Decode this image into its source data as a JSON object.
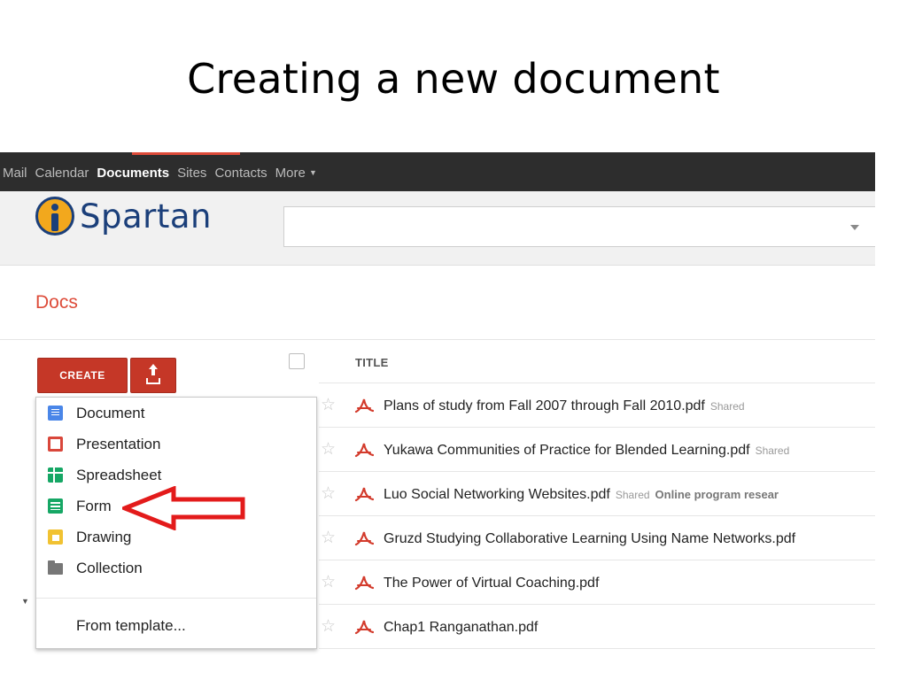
{
  "slide": {
    "title": "Creating a new document"
  },
  "topnav": {
    "items": [
      "Mail",
      "Calendar",
      "Documents",
      "Sites",
      "Contacts",
      "More"
    ],
    "active": "Documents"
  },
  "brand": {
    "logo_text": "Spartan"
  },
  "search": {
    "value": "",
    "placeholder": ""
  },
  "page": {
    "title": "Docs"
  },
  "toolbar": {
    "create_label": "CREATE",
    "upload_icon": "upload-icon"
  },
  "create_menu": {
    "items": [
      {
        "label": "Document",
        "icon": "document-icon",
        "color": "#4a86e8"
      },
      {
        "label": "Presentation",
        "icon": "presentation-icon",
        "color": "#d9473b"
      },
      {
        "label": "Spreadsheet",
        "icon": "spreadsheet-icon",
        "color": "#16a765"
      },
      {
        "label": "Form",
        "icon": "form-icon",
        "color": "#16a765"
      },
      {
        "label": "Drawing",
        "icon": "drawing-icon",
        "color": "#f1c232"
      },
      {
        "label": "Collection",
        "icon": "folder-icon",
        "color": "#777777"
      }
    ],
    "template_label": "From template..."
  },
  "annotation": {
    "type": "red outline arrow pointing to Form",
    "color": "#e31b1b"
  },
  "file_list": {
    "header": "TITLE",
    "rows": [
      {
        "name": "Plans of study from Fall 2007 through Fall 2010.pdf",
        "shared": "Shared",
        "tag": ""
      },
      {
        "name": "Yukawa Communities of Practice for Blended Learning.pdf",
        "shared": "Shared",
        "tag": ""
      },
      {
        "name": "Luo Social Networking Websites.pdf",
        "shared": "Shared",
        "tag": "Online program resear"
      },
      {
        "name": "Gruzd Studying Collaborative Learning Using Name Networks.pdf",
        "shared": "",
        "tag": ""
      },
      {
        "name": "The Power of Virtual Coaching.pdf",
        "shared": "",
        "tag": ""
      },
      {
        "name": "Chap1 Ranganathan.pdf",
        "shared": "",
        "tag": ""
      }
    ]
  },
  "colors": {
    "accent_red": "#dd4b39",
    "button_red": "#c53727",
    "topbar": "#2d2d2d",
    "brand_blue": "#1b3f7a",
    "brand_yellow": "#f2a81d"
  }
}
